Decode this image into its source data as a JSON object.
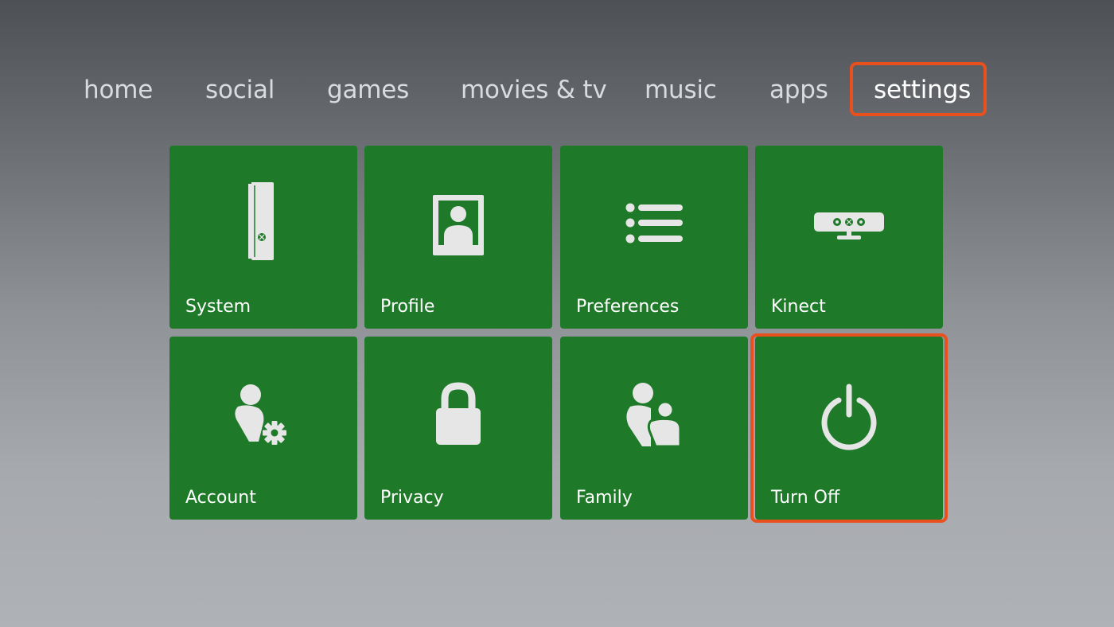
{
  "nav": {
    "items": [
      {
        "label": "home"
      },
      {
        "label": "social"
      },
      {
        "label": "games"
      },
      {
        "label": "movies & tv"
      },
      {
        "label": "music"
      },
      {
        "label": "apps"
      },
      {
        "label": "settings",
        "selected": true
      }
    ]
  },
  "tiles": [
    {
      "label": "System",
      "icon": "console-icon"
    },
    {
      "label": "Profile",
      "icon": "profile-icon"
    },
    {
      "label": "Preferences",
      "icon": "list-icon"
    },
    {
      "label": "Kinect",
      "icon": "kinect-sensor-icon"
    },
    {
      "label": "Account",
      "icon": "account-gear-icon"
    },
    {
      "label": "Privacy",
      "icon": "padlock-icon"
    },
    {
      "label": "Family",
      "icon": "family-icon"
    },
    {
      "label": "Turn Off",
      "icon": "power-icon",
      "highlighted": true
    }
  ],
  "colors": {
    "tile_green": "#1e7a28",
    "highlight_orange": "#e8501d",
    "icon_white": "#e6e6e6"
  }
}
